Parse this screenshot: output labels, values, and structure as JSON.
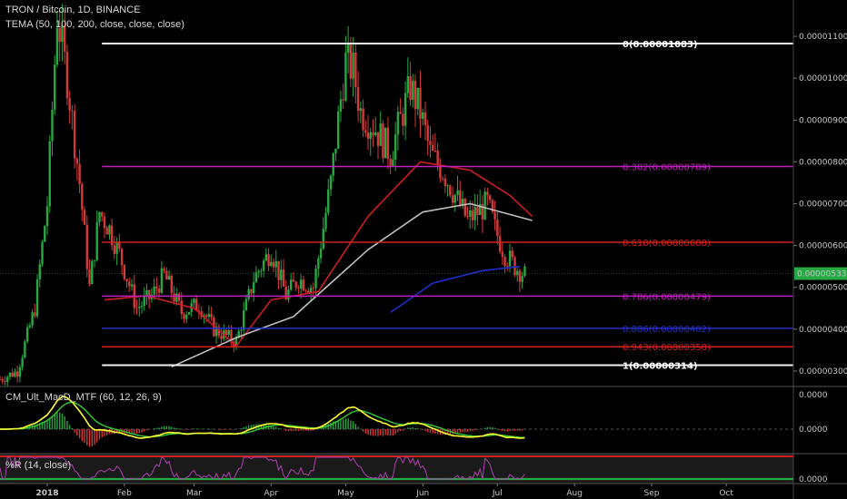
{
  "header": {
    "symbol_line": "TRON / Bitcoin, 1D, BINANCE",
    "indicator_line": "TEMA (50, 100, 200, close, close, close)",
    "macd_label": "CM_Ult_MacD_MTF (60, 12, 26, 9)",
    "wr_label": "%R (14, close)"
  },
  "colors": {
    "background": "#000000",
    "up_candle": "#26a843",
    "down_candle": "#d43a3a",
    "tema50": "#cc1f1f",
    "tema100": "#bfbfbf",
    "tema200": "#1f2fcc",
    "fib_white": "#f2f2f2",
    "fib_magenta": "#c21fc2",
    "fib_red": "#d42020",
    "fib_blue": "#2430c8",
    "macd_line": "#ffff33",
    "signal_line": "#33cc33",
    "wr_line": "#b03fb0",
    "current_price_bg": "#26a843"
  },
  "chart_data": {
    "type": "candlestick",
    "x_axis_labels": [
      "2018",
      "Feb",
      "Mar",
      "Apr",
      "May",
      "Jun",
      "Jul",
      "Aug",
      "Sep",
      "Oct"
    ],
    "x_axis_dates": [
      "2018-01-01",
      "2018-02-01",
      "2018-03-01",
      "2018-04-01",
      "2018-05-01",
      "2018-06-01",
      "2018-07-01",
      "2018-08-01",
      "2018-09-01",
      "2018-10-01"
    ],
    "date_range": [
      "2017-12-13",
      "2018-10-28"
    ],
    "price_axis_ticks": [
      "0.00000300",
      "0.00000400",
      "0.00000500",
      "0.00000600",
      "0.00000700",
      "0.00000800",
      "0.00000900",
      "0.00001000",
      "0.00001100"
    ],
    "ylim": [
      2.63e-06,
      1.187e-05
    ],
    "current_price": "0.00000533",
    "price_path": [
      [
        "2017-12-13",
        2.8e-06
      ],
      [
        "2017-12-20",
        3e-06
      ],
      [
        "2017-12-27",
        4.5e-06
      ],
      [
        "2018-01-01",
        7e-06
      ],
      [
        "2018-01-05",
        1.15e-05
      ],
      [
        "2018-01-09",
        1e-05
      ],
      [
        "2018-01-14",
        7.5e-06
      ],
      [
        "2018-01-18",
        5e-06
      ],
      [
        "2018-01-22",
        6.8e-06
      ],
      [
        "2018-01-26",
        6.4e-06
      ],
      [
        "2018-01-30",
        5.8e-06
      ],
      [
        "2018-02-06",
        4.5e-06
      ],
      [
        "2018-02-12",
        4.8e-06
      ],
      [
        "2018-02-17",
        5.3e-06
      ],
      [
        "2018-02-24",
        4.4e-06
      ],
      [
        "2018-03-03",
        4.6e-06
      ],
      [
        "2018-03-09",
        4e-06
      ],
      [
        "2018-03-18",
        3.7e-06
      ],
      [
        "2018-03-25",
        5.2e-06
      ],
      [
        "2018-04-01",
        5.9e-06
      ],
      [
        "2018-04-07",
        4.8e-06
      ],
      [
        "2018-04-12",
        5.2e-06
      ],
      [
        "2018-04-18",
        5e-06
      ],
      [
        "2018-04-25",
        7.5e-06
      ],
      [
        "2018-04-29",
        9.5e-06
      ],
      [
        "2018-05-01",
        1.04e-05
      ],
      [
        "2018-05-04",
        1.02e-05
      ],
      [
        "2018-05-07",
        9.2e-06
      ],
      [
        "2018-05-13",
        8.8e-06
      ],
      [
        "2018-05-19",
        8.2e-06
      ],
      [
        "2018-05-23",
        9e-06
      ],
      [
        "2018-05-27",
        9.8e-06
      ],
      [
        "2018-05-31",
        9.2e-06
      ],
      [
        "2018-06-04",
        8.2e-06
      ],
      [
        "2018-06-09",
        7.8e-06
      ],
      [
        "2018-06-14",
        7.2e-06
      ],
      [
        "2018-06-19",
        6.6e-06
      ],
      [
        "2018-06-23",
        6.8e-06
      ],
      [
        "2018-06-27",
        7e-06
      ],
      [
        "2018-06-30",
        6.4e-06
      ],
      [
        "2018-07-04",
        5.8e-06
      ],
      [
        "2018-07-08",
        5.5e-06
      ],
      [
        "2018-07-12",
        5.3e-06
      ]
    ],
    "indicators": [
      {
        "name": "TEMA 50",
        "points": [
          [
            "2018-01-24",
            4.7e-06
          ],
          [
            "2018-02-10",
            4.8e-06
          ],
          [
            "2018-03-01",
            4.5e-06
          ],
          [
            "2018-03-18",
            3.6e-06
          ],
          [
            "2018-04-01",
            4.7e-06
          ],
          [
            "2018-04-20",
            4.9e-06
          ],
          [
            "2018-05-10",
            6.7e-06
          ],
          [
            "2018-05-31",
            8e-06
          ],
          [
            "2018-06-20",
            7.8e-06
          ],
          [
            "2018-07-06",
            7.2e-06
          ],
          [
            "2018-07-15",
            6.7e-06
          ]
        ]
      },
      {
        "name": "TEMA 100",
        "points": [
          [
            "2018-02-20",
            3.1e-06
          ],
          [
            "2018-03-18",
            3.8e-06
          ],
          [
            "2018-04-10",
            4.3e-06
          ],
          [
            "2018-05-10",
            5.9e-06
          ],
          [
            "2018-06-01",
            6.8e-06
          ],
          [
            "2018-06-20",
            7e-06
          ],
          [
            "2018-07-15",
            6.6e-06
          ]
        ]
      },
      {
        "name": "TEMA 200",
        "points": [
          [
            "2018-05-19",
            4.4e-06
          ],
          [
            "2018-06-05",
            5.1e-06
          ],
          [
            "2018-06-25",
            5.4e-06
          ],
          [
            "2018-07-10",
            5.5e-06
          ]
        ]
      }
    ],
    "fib_levels": [
      {
        "label": "0(0.00001083)",
        "value": 1.083e-05,
        "color_key": "fib_white"
      },
      {
        "label": "0.382(0.00000789)",
        "value": 7.89e-06,
        "color_key": "fib_magenta"
      },
      {
        "label": "0.618(0.00000608)",
        "value": 6.08e-06,
        "color_key": "fib_red"
      },
      {
        "label": "0.786(0.00000479)",
        "value": 4.79e-06,
        "color_key": "fib_magenta"
      },
      {
        "label": "0.886(0.00000402)",
        "value": 4.02e-06,
        "color_key": "fib_blue"
      },
      {
        "label": "0.943(0.00000358)",
        "value": 3.58e-06,
        "color_key": "fib_red"
      },
      {
        "label": "1(0.00000314)",
        "value": 3.14e-06,
        "color_key": "fib_white"
      }
    ],
    "fib_start": "2018-01-23",
    "macd_axis_ticks": [
      "0.0000",
      "0.0000"
    ],
    "wr_axis_ticks": [
      "0.0000"
    ],
    "grid": false
  }
}
